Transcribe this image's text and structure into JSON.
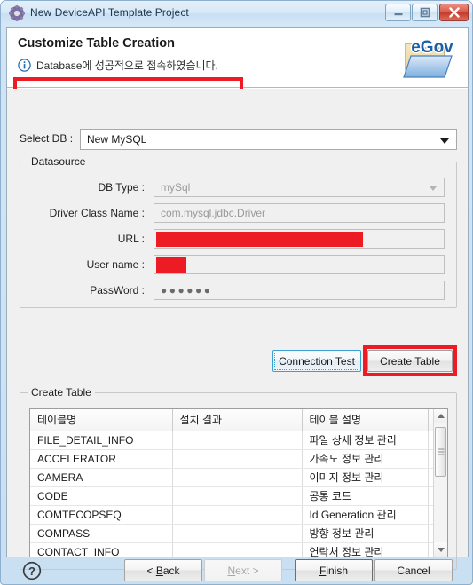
{
  "window": {
    "title": "New DeviceAPI Template Project",
    "icon": "gear-icon",
    "controls": {
      "minimize": "minimize-icon",
      "maximize": "restore-icon",
      "close": "close-icon"
    }
  },
  "header": {
    "page_title": "Customize Table Creation",
    "message": "Database에 성공적으로 접속하였습니다.",
    "message_icon": "info-icon",
    "logo_text": "eGov"
  },
  "select_db": {
    "label": "Select DB :",
    "value": "New MySQL",
    "arrow_icon": "chevron-down-icon"
  },
  "datasource": {
    "legend": "Datasource",
    "fields": [
      {
        "label": "DB Type :",
        "value": "mySql",
        "kind": "combo-disabled"
      },
      {
        "label": "Driver Class Name :",
        "value": "com.mysql.jdbc.Driver",
        "kind": "text-disabled"
      },
      {
        "label": "URL :",
        "value": "",
        "kind": "redacted",
        "redact_width": 233
      },
      {
        "label": "User name :",
        "value": "",
        "kind": "redacted",
        "redact_width": 34
      },
      {
        "label": "PassWord :",
        "value": "●●●●●●",
        "kind": "password"
      }
    ],
    "buttons": {
      "connection_test": "Connection Test",
      "create_table": "Create Table"
    }
  },
  "create_table": {
    "legend": "Create Table",
    "columns": [
      "테이블명",
      "설치 결과",
      "테이블 설명",
      ""
    ],
    "rows": [
      [
        "FILE_DETAIL_INFO",
        "",
        "파일 상세 정보 관리",
        ""
      ],
      [
        "ACCELERATOR",
        "",
        "가속도 정보 관리",
        ""
      ],
      [
        "CAMERA",
        "",
        "이미지 정보 관리",
        ""
      ],
      [
        "CODE",
        "",
        "공통 코드",
        ""
      ],
      [
        "COMTECOPSEQ",
        "",
        "Id Generation 관리",
        ""
      ],
      [
        "COMPASS",
        "",
        "방향 정보 관리",
        ""
      ],
      [
        "CONTACT_INFO",
        "",
        "연락처 정보 관리",
        ""
      ]
    ]
  },
  "footer": {
    "help_icon": "help-icon",
    "back": "< Back",
    "back_mnemonic": "B",
    "next": "Next >",
    "next_mnemonic": "N",
    "finish": "Finish",
    "finish_mnemonic": "F",
    "cancel": "Cancel"
  },
  "colors": {
    "redaction": "#ed1c24",
    "title_text": "#21364c",
    "info_blue": "#1f6fb5",
    "focus_blue": "#3c9fd4",
    "close_red": "#c33a2b"
  }
}
